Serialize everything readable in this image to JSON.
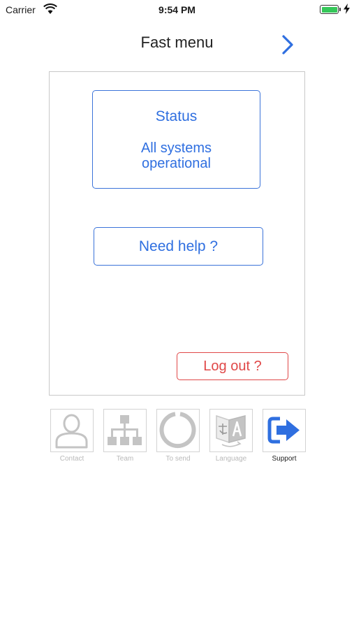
{
  "status_bar": {
    "carrier": "Carrier",
    "time": "9:54 PM"
  },
  "nav": {
    "title": "Fast menu",
    "forward_icon": "chevron-right-icon"
  },
  "card": {
    "status_title": "Status",
    "status_text": "All systems operational",
    "help_label": "Need help ?",
    "logout_label": "Log out ?"
  },
  "colors": {
    "accent": "#2f6fe0",
    "danger": "#e04848",
    "inactive": "#c4c4c4"
  },
  "tabs": [
    {
      "label": "Contact",
      "icon": "person-icon",
      "active": false
    },
    {
      "label": "Team",
      "icon": "org-chart-icon",
      "active": false
    },
    {
      "label": "To send",
      "icon": "loading-ring-icon",
      "active": false
    },
    {
      "label": "Language",
      "icon": "translate-icon",
      "active": false
    },
    {
      "label": "Support",
      "icon": "exit-arrow-icon",
      "active": true
    }
  ]
}
